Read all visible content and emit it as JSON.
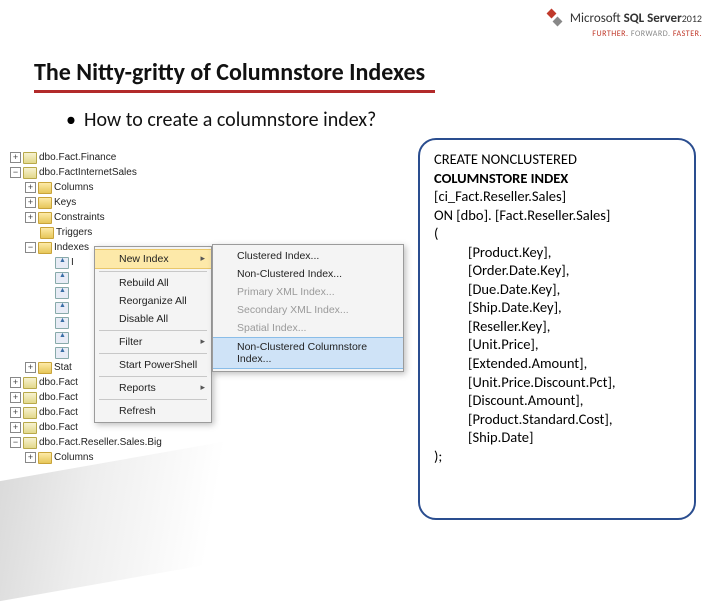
{
  "logo": {
    "product_prefix": "Microsoft",
    "product_name": "SQL Server",
    "year": "2012",
    "tagline_1": "FURTHER.",
    "tagline_2": "FORWARD.",
    "tagline_3": "FASTER."
  },
  "title": "The Nitty-gritty of Columnstore Indexes",
  "bullet": "How to create a columnstore index?",
  "tree": {
    "n0": "dbo.Fact.Finance",
    "n1": "dbo.FactInternetSales",
    "n2": "Columns",
    "n3": "Keys",
    "n4": "Constraints",
    "n5": "Triggers",
    "n6": "Indexes",
    "n7": "I",
    "n8": "Stat",
    "n9": "dbo.Fact",
    "n10": "dbo.Fact",
    "n11": "dbo.Fact",
    "n12": "dbo.Fact",
    "n13": "dbo.Fact.Reseller.Sales.Big",
    "n14": "Columns"
  },
  "context_menu": {
    "m0": "New Index",
    "m1": "Rebuild All",
    "m2": "Reorganize All",
    "m3": "Disable All",
    "m4": "Filter",
    "m5": "Start PowerShell",
    "m6": "Reports",
    "m7": "Refresh"
  },
  "submenu": {
    "s0": "Clustered Index...",
    "s1": "Non-Clustered Index...",
    "s2": "Primary XML Index...",
    "s3": "Secondary XML Index...",
    "s4": "Spatial Index...",
    "s5": "Non-Clustered Columnstore Index..."
  },
  "sql": {
    "l1": "CREATE NONCLUSTERED",
    "l2": "COLUMNSTORE INDEX",
    "l3": "[ci_Fact.Reseller.Sales]",
    "l4": "ON [dbo]. [Fact.Reseller.Sales]",
    "l5": "(",
    "c1": "[Product.Key],",
    "c2": "[Order.Date.Key],",
    "c3": "[Due.Date.Key],",
    "c4": "[Ship.Date.Key],",
    "c5": "[Reseller.Key],",
    "c6": "[Unit.Price],",
    "c7": "[Extended.Amount],",
    "c8": "[Unit.Price.Discount.Pct],",
    "c9": "[Discount.Amount],",
    "c10": "[Product.Standard.Cost],",
    "c11": "[Ship.Date]",
    "l6": ");"
  }
}
